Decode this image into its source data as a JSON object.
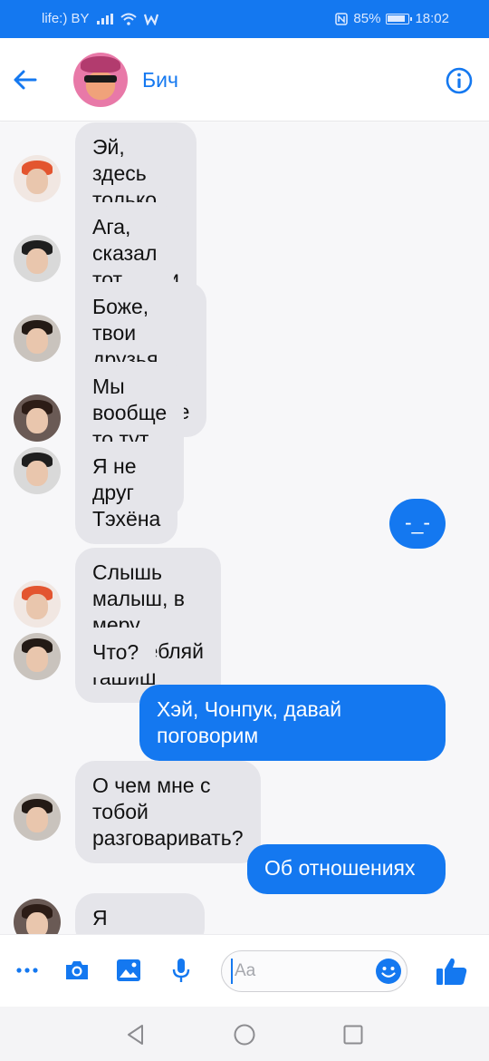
{
  "status_bar": {
    "carrier": "life:) BY",
    "battery_percent": "85%",
    "time": "18:02",
    "icons": [
      "signal-icon",
      "wifi-icon",
      "app-w-icon",
      "nfc-icon",
      "battery-icon"
    ]
  },
  "header": {
    "contact_name": "Бич",
    "back_icon": "arrow-left-icon",
    "info_icon": "info-icon"
  },
  "messages": [
    {
      "side": "in",
      "text": "Эй, здесь только милый и\nдобрый фрэндли контент",
      "avatar": "red-hair-boy"
    },
    {
      "side": "in",
      "text": "Ага, сказал тот что чуть\nменя не убил",
      "avatar": "boy-in-cap"
    },
    {
      "side": "in",
      "text": "Боже, твои друзья такие.....\nСтранные",
      "avatar": "black-hair-boy"
    },
    {
      "side": "in",
      "text": "Мы вообще то тут тоже\nесть",
      "avatar": "brown-hair-boy"
    },
    {
      "side": "in",
      "text": "Я не друг Тэхёна",
      "avatar": "boy-in-cap"
    },
    {
      "side": "out",
      "text": "-_-"
    },
    {
      "side": "in",
      "text": "Слышь малыш, в меру\nупотребляй гашиш",
      "avatar": "red-hair-boy"
    },
    {
      "side": "in",
      "text": "Что?",
      "avatar": "black-hair-boy"
    },
    {
      "side": "out",
      "text": "Хэй, Чонпук, давай\nпоговорим"
    },
    {
      "side": "in",
      "text": "О чем мне с тобой\nразговаривать?",
      "avatar": "black-hair-boy"
    },
    {
      "side": "out",
      "text": "Об отношениях"
    },
    {
      "side": "in",
      "text": "Я сваливаю",
      "avatar": "brown-hair-boy"
    }
  ],
  "composer": {
    "placeholder": "Aa",
    "value": "",
    "tools": [
      "more-icon",
      "camera-icon",
      "image-icon",
      "microphone-icon"
    ],
    "emoji_icon": "emoji-icon",
    "like_icon": "thumbs-up-icon"
  },
  "nav_bar": {
    "buttons": [
      "back-triangle-icon",
      "home-circle-icon",
      "recents-square-icon"
    ]
  },
  "colors": {
    "accent": "#1478f0",
    "incoming_bubble": "#e5e5ea",
    "chat_background": "#f7f7f9"
  }
}
